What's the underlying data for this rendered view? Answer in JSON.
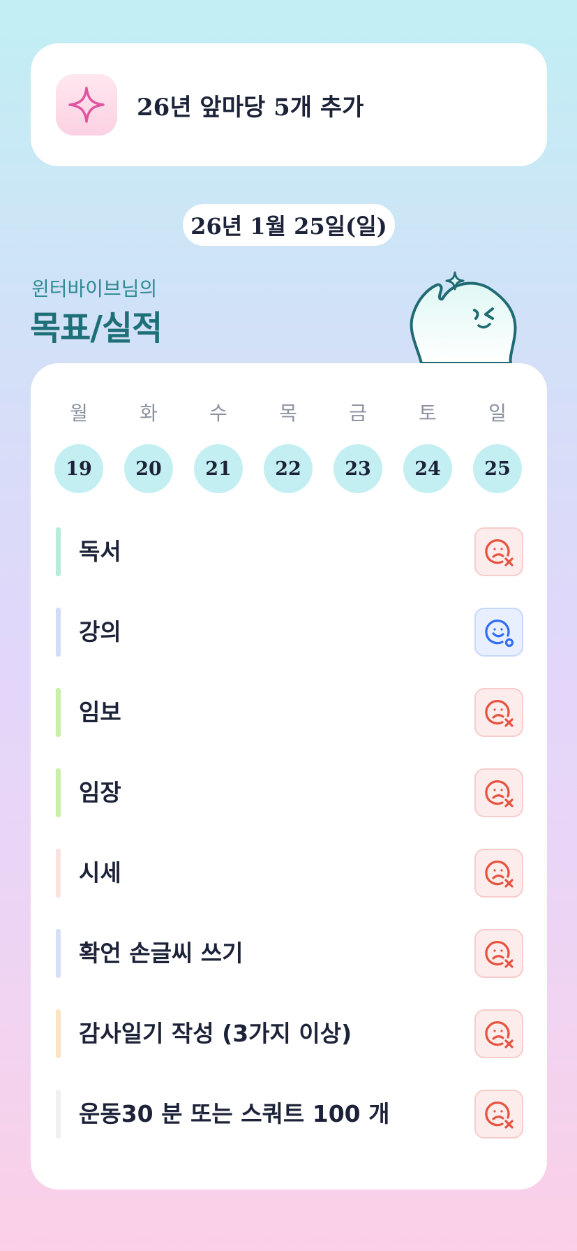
{
  "goal_card": {
    "icon": "sparkle-icon",
    "text": "26년 앞마당 5개 추가"
  },
  "date_pill": "26년 1월 25일(일)",
  "header": {
    "subtitle": "윈터바이브님의",
    "title": "목표/실적",
    "mascot": "ghost-mascot-icon"
  },
  "week": {
    "days": [
      "월",
      "화",
      "수",
      "목",
      "금",
      "토",
      "일"
    ],
    "dates": [
      "19",
      "20",
      "21",
      "22",
      "23",
      "24",
      "25"
    ]
  },
  "tasks": [
    {
      "label": "독서",
      "status": "fail",
      "color": "#b6ecd8"
    },
    {
      "label": "강의",
      "status": "done",
      "color": "#d3dcf7"
    },
    {
      "label": "임보",
      "status": "fail",
      "color": "#c8f0a8"
    },
    {
      "label": "임장",
      "status": "fail",
      "color": "#c8f0a8"
    },
    {
      "label": "시세",
      "status": "fail",
      "color": "#fde0e0"
    },
    {
      "label": "확언 손글씨 쓰기",
      "status": "fail",
      "color": "#d6def8"
    },
    {
      "label": "감사일기 작성 (3가지 이상)",
      "status": "fail",
      "color": "#fde3c4"
    },
    {
      "label": "운동30 분 또는 스쿼트 100 개",
      "status": "fail",
      "color": "#f0f0f2"
    }
  ],
  "colors": {
    "accent_teal": "#1d6f78",
    "fail_red": "#e5533d",
    "done_blue": "#2f6df0",
    "date_circle": "#c3eff3"
  }
}
